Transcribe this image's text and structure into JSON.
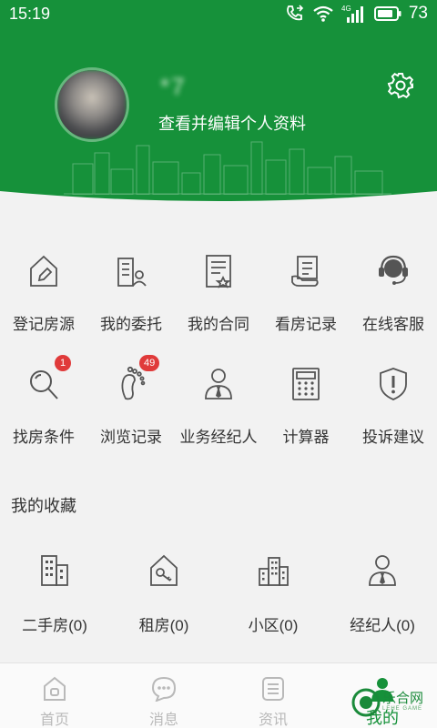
{
  "status_bar": {
    "time": "15:19",
    "network": "4G",
    "battery": "73",
    "icons": [
      "call-forwarding-icon",
      "wifi-icon",
      "signal-icon",
      "battery-icon"
    ]
  },
  "profile": {
    "username": "*7",
    "edit_link": "查看并编辑个人资料",
    "settings_icon": "gear-icon"
  },
  "menu": {
    "row1": [
      {
        "label": "登记房源",
        "icon": "house-pen-icon"
      },
      {
        "label": "我的委托",
        "icon": "building-person-icon"
      },
      {
        "label": "我的合同",
        "icon": "contract-icon"
      },
      {
        "label": "看房记录",
        "icon": "record-icon"
      },
      {
        "label": "在线客服",
        "icon": "headset-icon"
      }
    ],
    "row2": [
      {
        "label": "找房条件",
        "icon": "magnifier-icon",
        "badge": "1"
      },
      {
        "label": "浏览记录",
        "icon": "footprint-icon",
        "badge": "49"
      },
      {
        "label": "业务经纪人",
        "icon": "agent-icon"
      },
      {
        "label": "计算器",
        "icon": "calculator-icon"
      },
      {
        "label": "投诉建议",
        "icon": "shield-exclamation-icon"
      }
    ]
  },
  "favorites": {
    "title": "我的收藏",
    "items": [
      {
        "label": "二手房(0)",
        "icon": "buildings-icon"
      },
      {
        "label": "租房(0)",
        "icon": "house-key-icon"
      },
      {
        "label": "小区(0)",
        "icon": "community-icon"
      },
      {
        "label": "经纪人(0)",
        "icon": "agent-icon"
      }
    ]
  },
  "bottom_nav": {
    "items": [
      {
        "label": "首页",
        "icon": "home-icon",
        "active": false
      },
      {
        "label": "消息",
        "icon": "chat-icon",
        "active": false
      },
      {
        "label": "资讯",
        "icon": "news-icon",
        "active": false
      },
      {
        "label": "我的",
        "icon": "profile-icon",
        "active": true
      }
    ]
  },
  "watermark": {
    "text": "乐合网",
    "sub": "LEHE GAME"
  },
  "colors": {
    "brand_green": "#16913a",
    "badge_red": "#e03a3a",
    "icon_gray": "#555555",
    "inactive_nav": "#b9b9b9"
  }
}
